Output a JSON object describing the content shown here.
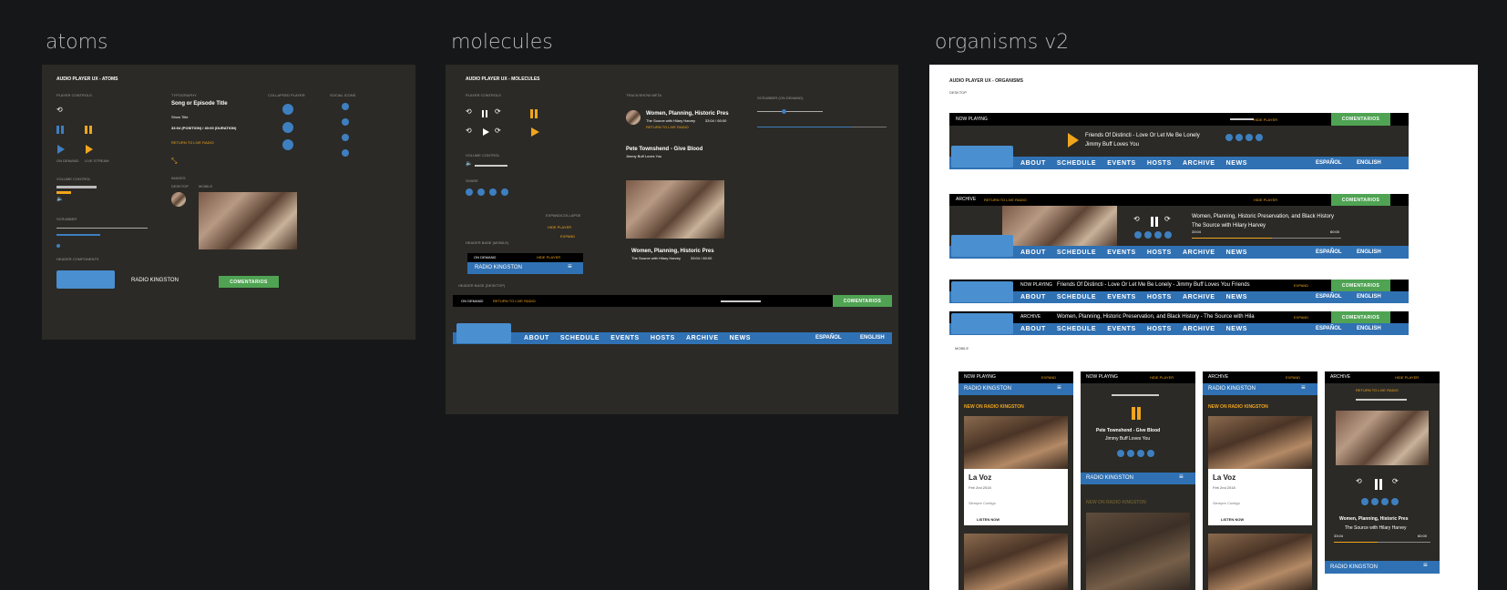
{
  "labels": {
    "atoms": "atoms",
    "molecules": "molecules",
    "organisms": "organisms v2"
  },
  "atoms": {
    "title": "AUDIO PLAYER UX - ATOMS",
    "player_controls": "PLAYER CONTROLS",
    "typography": "TYPOGRAPHY",
    "collapsed_player": "COLLAPSED PLAYER",
    "social_icons": "SOCIAL ICONS",
    "song_title": "Song or Episode Title",
    "show_title": "Show Title",
    "time": "33:04 (POSITION) / 40:00 (DURATION)",
    "return_live": "RETURN TO LIVE RADIO",
    "on_demand": "ON DEMAND",
    "live_stream": "LIVE STREAM",
    "images": "IMAGES",
    "desktop": "DESKTOP",
    "mobile": "MOBILE",
    "volume_control": "VOLUME CONTROL",
    "scrubber": "SCRUBBER",
    "header_components": "HEADER COMPONENTS",
    "radio_kingston": "RADIO KINGSTON",
    "comentarios": "COMENTARIOS"
  },
  "molecules": {
    "title": "AUDIO PLAYER UX - MOLECULES",
    "player_controls": "PLAYER CONTROLS",
    "track_show_meta": "TRACK/SHOW META",
    "track1": "Women, Planning, Historic Pres",
    "track1_sub": "The Source with Hilary Harvey",
    "track1_time": "33:04 / 60:00",
    "return_live": "RETURN TO LIVE RADIO",
    "track2": "Pete Townshend - Give Blood",
    "track2_sub": "Jimmy Buff Loves You",
    "scrubber_on_demand": "SCRUBBER (ON DEMAND)",
    "volume_control": "VOLUME CONTROL",
    "share": "SHARE",
    "expand_collapse": "EXPAND/COLLAPSE",
    "hide_player": "HIDE PLAYER",
    "expand": "EXPAND",
    "header_base_mobile": "HEADER BASE (MOBILE)",
    "on_demand": "ON DEMAND",
    "radio_kingston": "RADIO KINGSTON",
    "header_base_desktop": "HEADER BASE (DESKTOP)",
    "comentarios": "COMENTARIOS",
    "track3": "Women, Planning, Historic Pres",
    "track3_sub": "The Source with Hilary Harvey",
    "track3_time": "33:04 / 60:00",
    "nav": [
      "ABOUT",
      "SCHEDULE",
      "EVENTS",
      "HOSTS",
      "ARCHIVE",
      "NEWS"
    ],
    "espanol": "ESPAÑOL",
    "english": "ENGLISH"
  },
  "organisms": {
    "title": "AUDIO PLAYER UX - ORGANISMS",
    "desktop": "DESKTOP",
    "now_playing": "NOW PLAYING",
    "hide_player": "HIDE PLAYER",
    "comentarios": "COMENTARIOS",
    "np_track": "Friends Of Distincti - Love Or Let Me Be Lonely",
    "np_artist": "Jimmy Buff Loves You",
    "nav": [
      "ABOUT",
      "SCHEDULE",
      "EVENTS",
      "HOSTS",
      "ARCHIVE",
      "NEWS"
    ],
    "espanol": "ESPAÑOL",
    "english": "ENGLISH",
    "archive": "ARCHIVE",
    "return_live": "RETURN TO LIVE RADIO",
    "ar_track": "Women, Planning, Historic Preservation, and Black History",
    "ar_show": "The Source with Hilary Harvey",
    "ar_pos": "33:04",
    "ar_dur": "60:00",
    "collapsed_np": "Friends Of Distincti - Love Or Let Me Be Lonely - Jimmy Buff Loves You    Friends",
    "expand": "EXPAND",
    "collapsed_ar": "Women, Planning, Historic Preservation, and Black History - The Source with Hila",
    "mobile": "MOBILE",
    "radio_kingston": "RADIO KINGSTON",
    "new_on": "NEW ON RADIO KINGSTON",
    "la_voz": "La Voz",
    "la_voz_date": "Feb 2nd 2018",
    "sempre": "Siempre Contigo",
    "listen_now": "LISTEN NOW",
    "pete": "Pete Townshend - Give Blood",
    "jimmy": "Jimmy Buff Loves You",
    "women": "Women, Planning, Historic Pres",
    "source": "The Source with Hilary Harvey",
    "m_pos": "33:04",
    "m_dur": "60:00"
  }
}
